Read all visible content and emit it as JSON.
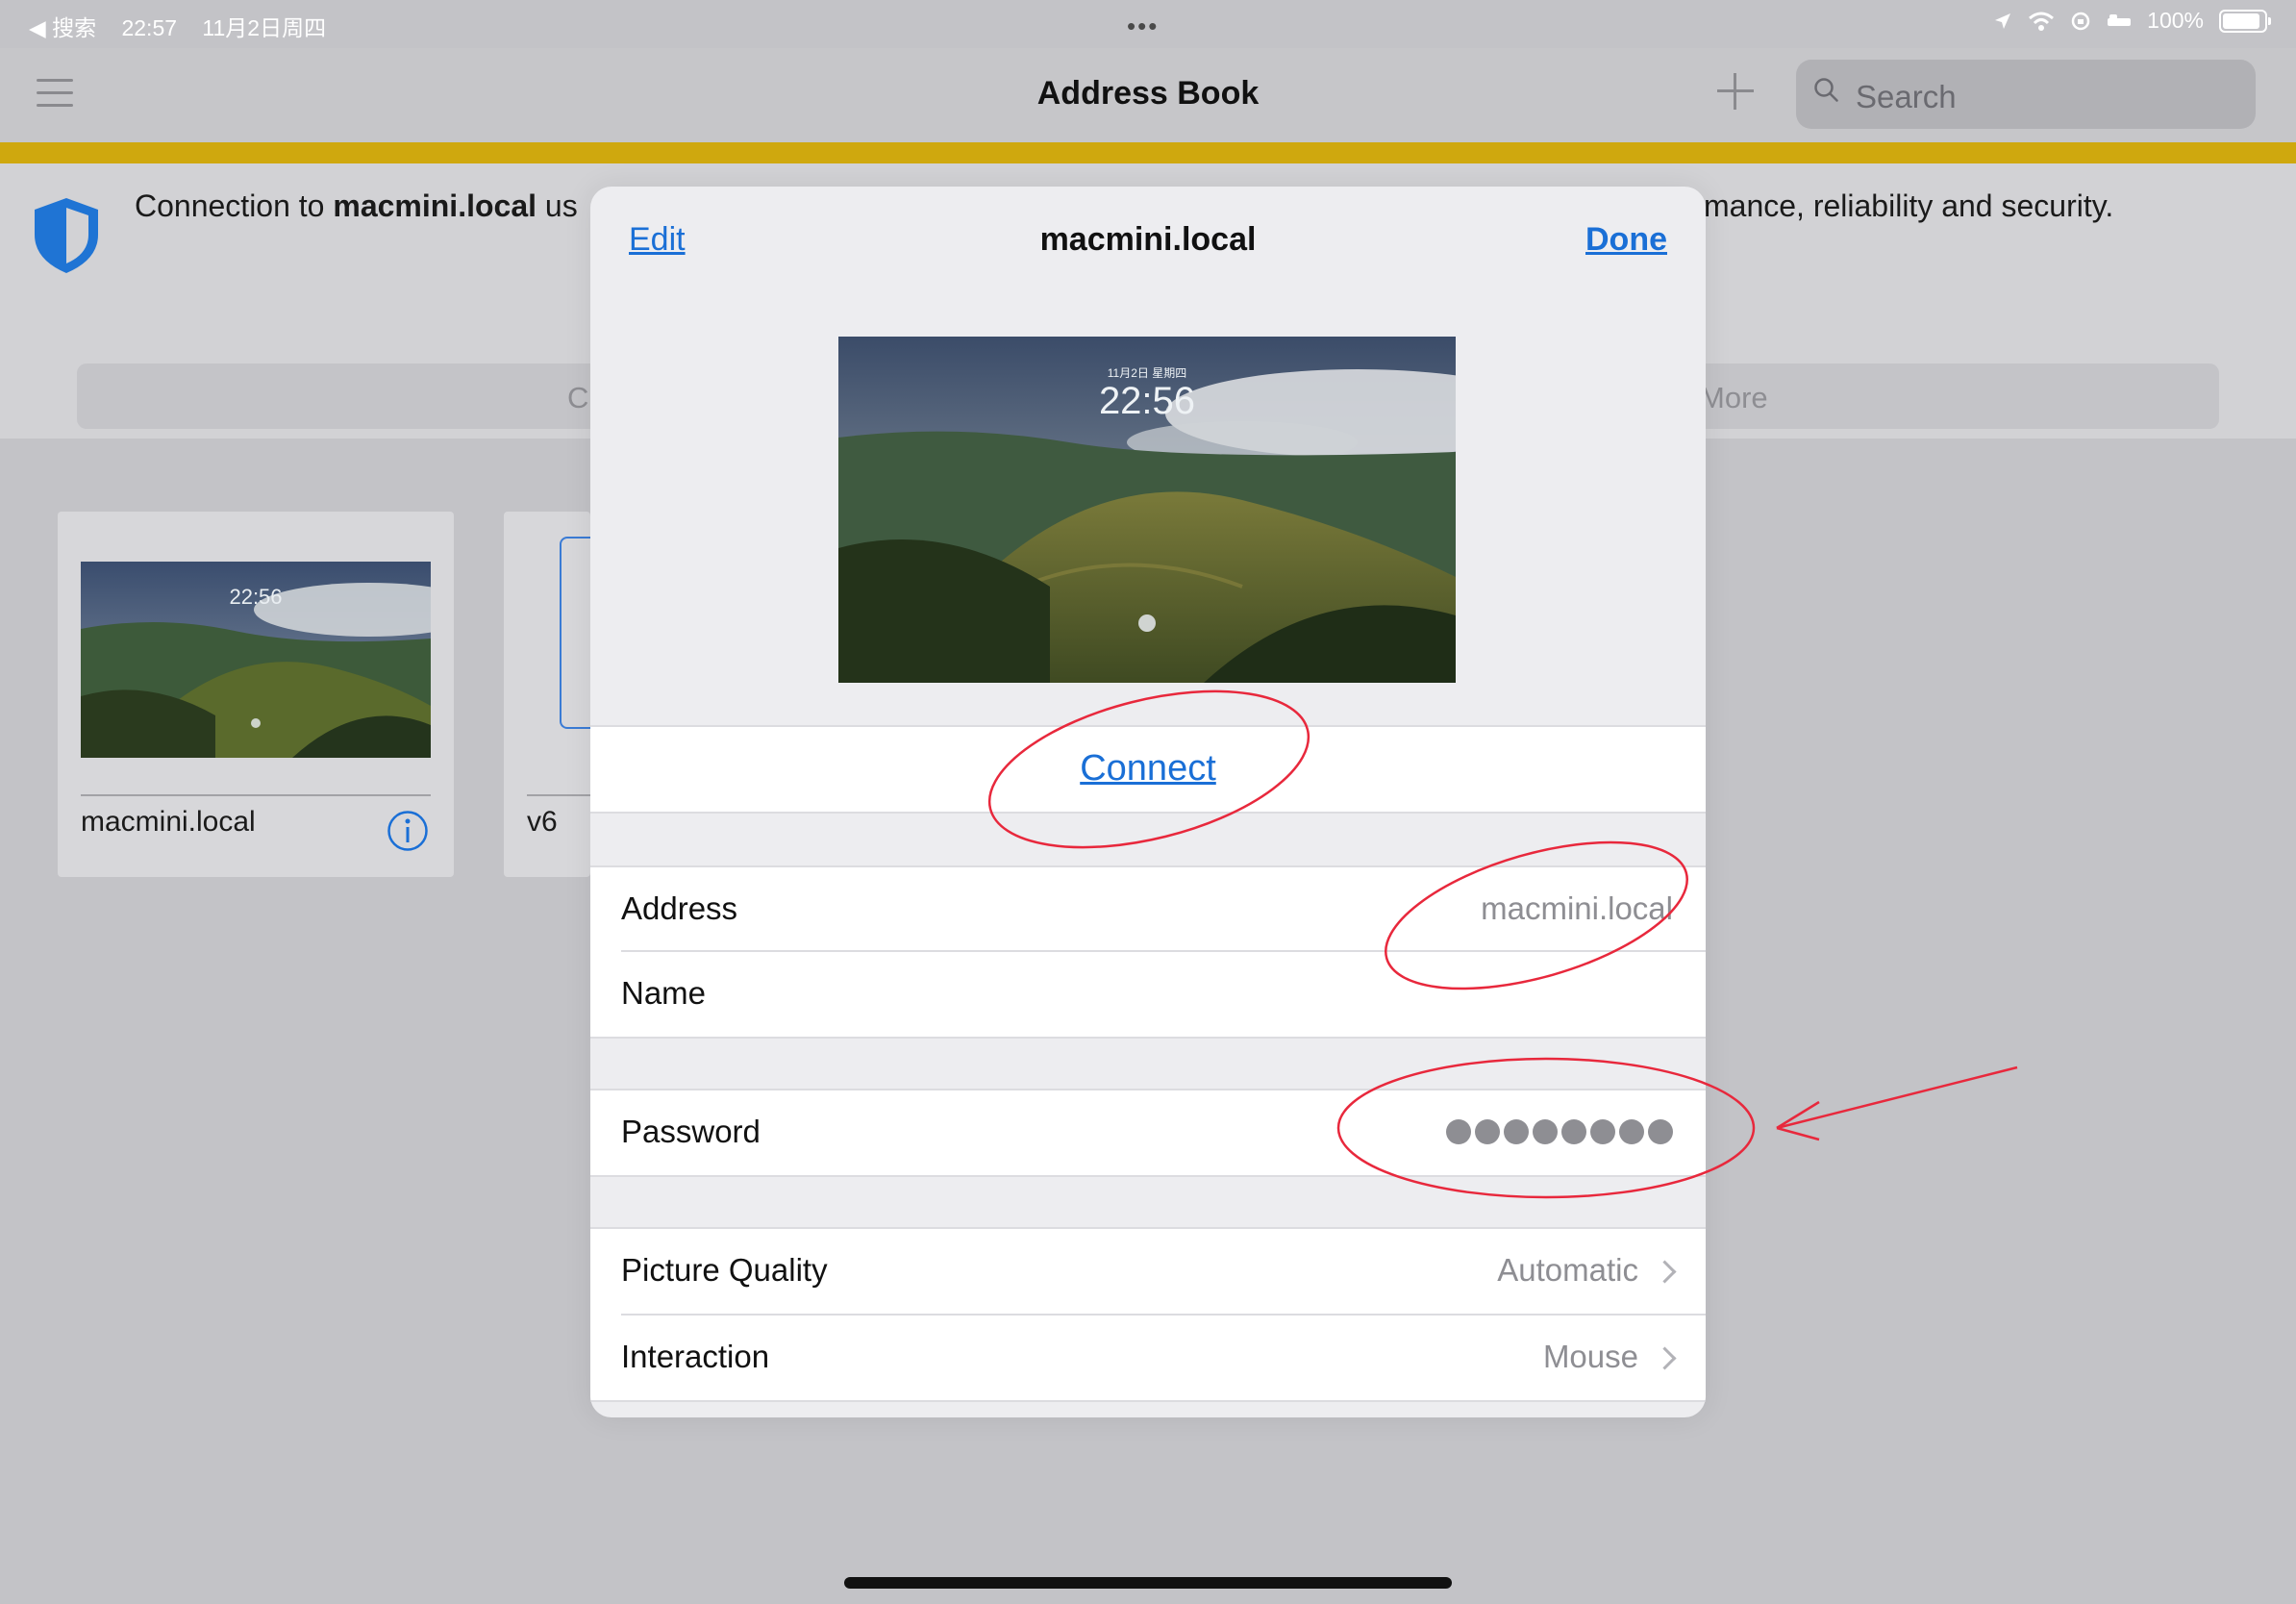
{
  "status_bar": {
    "back_label": "◀ 搜索",
    "time": "22:57",
    "date": "11月2日周四",
    "dots": "•••",
    "battery": "100%",
    "battery_level": 1.0
  },
  "nav": {
    "title": "Address Book",
    "search_placeholder": "Search"
  },
  "banner": {
    "text_prefix": "Connection to ",
    "text_host": "macmini.local",
    "text_suffix_visible": " us",
    "text_right": "mance, reliability and security."
  },
  "segmented": {
    "left_label": "C",
    "right_label": "More"
  },
  "cards": [
    {
      "label": "macmini.local",
      "thumb_time": "22:56"
    },
    {
      "label": "v6"
    }
  ],
  "modal": {
    "edit_label": "Edit",
    "title": "macmini.local",
    "done_label": "Done",
    "preview_date": "11月2日 星期四",
    "preview_time": "22:56",
    "connect_label": "Connect",
    "address_label": "Address",
    "address_value": "macmini.local",
    "name_label": "Name",
    "password_label": "Password",
    "password_dot_count": 8,
    "quality_label": "Picture Quality",
    "quality_value": "Automatic",
    "interaction_label": "Interaction",
    "interaction_value": "Mouse"
  },
  "colors": {
    "accent": "#1a6fd6",
    "banner_yellow": "#cfa80e",
    "annotation_red": "#e8283c"
  },
  "icons": [
    "menu-icon",
    "plus-icon",
    "search-icon",
    "shield-icon",
    "info-icon",
    "chevron-right-icon",
    "location-icon",
    "wifi-icon",
    "battery-icon"
  ]
}
